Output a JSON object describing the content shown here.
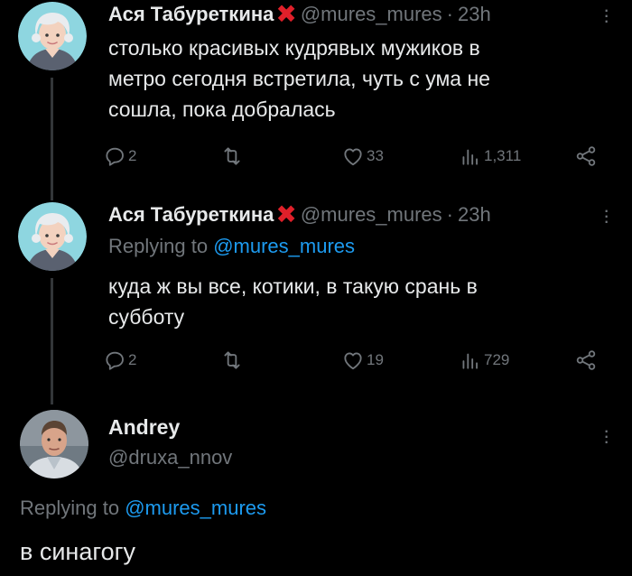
{
  "tweets": [
    {
      "author_name": "Ася Табуреткина",
      "badge": "✖",
      "handle": "@mures_mures",
      "separator": "·",
      "time": "23h",
      "text_lines": [
        "столько красивых кудрявых мужиков в",
        "метро сегодня встретила, чуть с ума не",
        "сошла, пока добралась"
      ],
      "replies": "2",
      "retweets": "",
      "likes": "33",
      "views": "1,311"
    },
    {
      "author_name": "Ася Табуреткина",
      "badge": "✖",
      "handle": "@mures_mures",
      "separator": "·",
      "time": "23h",
      "replying_prefix": "Replying to ",
      "replying_to": "@mures_mures",
      "text_lines": [
        "куда ж вы все, котики, в такую срань в",
        "субботу"
      ],
      "replies": "2",
      "retweets": "",
      "likes": "19",
      "views": "729"
    }
  ],
  "main_tweet": {
    "author_name": "Andrey",
    "handle": "@druxa_nnov",
    "replying_prefix": "Replying to ",
    "replying_to": "@mures_mures",
    "text": "в синагогу"
  },
  "icons": [
    "reply-icon",
    "retweet-icon",
    "like-icon",
    "views-icon",
    "share-icon",
    "more-icon"
  ],
  "colors": {
    "background": "#000000",
    "text": "#e7e9ea",
    "muted": "#71767b",
    "mention": "#1d9bf0",
    "badge": "#e0202a"
  }
}
